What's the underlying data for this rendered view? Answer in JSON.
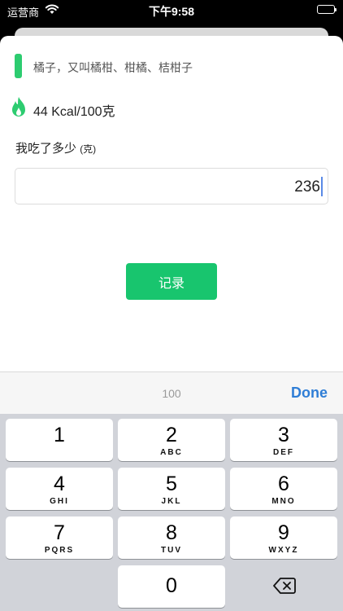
{
  "status_bar": {
    "carrier": "运营商",
    "time": "下午9:58"
  },
  "food": {
    "name": "橘子，又叫橘柑、柑橘、桔柑子",
    "calories": "44 Kcal/100克",
    "accent_color": "#2dcc70"
  },
  "amount": {
    "label": "我吃了多少",
    "unit": "(克)",
    "value": "236"
  },
  "record_button": {
    "label": "记录",
    "color": "#18c56e"
  },
  "toolbar": {
    "suggestion": "100",
    "done_label": "Done"
  },
  "keyboard": {
    "keys": [
      {
        "digit": "1",
        "letters": ""
      },
      {
        "digit": "2",
        "letters": "ABC"
      },
      {
        "digit": "3",
        "letters": "DEF"
      },
      {
        "digit": "4",
        "letters": "GHI"
      },
      {
        "digit": "5",
        "letters": "JKL"
      },
      {
        "digit": "6",
        "letters": "MNO"
      },
      {
        "digit": "7",
        "letters": "PQRS"
      },
      {
        "digit": "8",
        "letters": "TUV"
      },
      {
        "digit": "9",
        "letters": "WXYZ"
      },
      {
        "digit": "0",
        "letters": ""
      }
    ],
    "backspace_icon": "delete-backward-icon"
  }
}
